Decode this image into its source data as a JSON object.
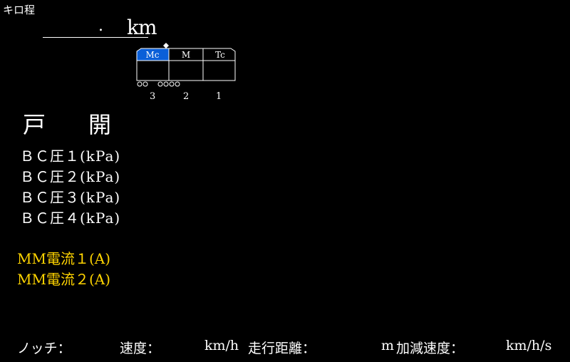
{
  "kilo": {
    "label": "キロ程",
    "separator": ".",
    "unit": "km"
  },
  "train": {
    "cars": [
      {
        "label": "Mc",
        "selected": true
      },
      {
        "label": "M",
        "selected": false
      },
      {
        "label": "Tc",
        "selected": false
      }
    ],
    "car_numbers": [
      "3",
      "2",
      "1"
    ],
    "colors": {
      "selected": "#0a5fd8",
      "line": "#ffffff"
    }
  },
  "door": {
    "status": "戸　開"
  },
  "bc_pressures": [
    "ＢＣ圧１(kPa)",
    "ＢＣ圧２(kPa)",
    "ＢＣ圧３(kPa)",
    "ＢＣ圧４(kPa)"
  ],
  "mm_currents": [
    "MM電流１(A)",
    "MM電流２(A)"
  ],
  "status_bar": {
    "notch_label": "ノッチ：",
    "speed_label": "速度：",
    "speed_unit": "km/h",
    "distance_label": "走行距離：",
    "distance_unit": "m",
    "accel_label": "加減速度：",
    "accel_unit": "km/h/s"
  },
  "colors": {
    "background": "#000000",
    "text": "#ffffff",
    "highlight": "#ffd400"
  }
}
